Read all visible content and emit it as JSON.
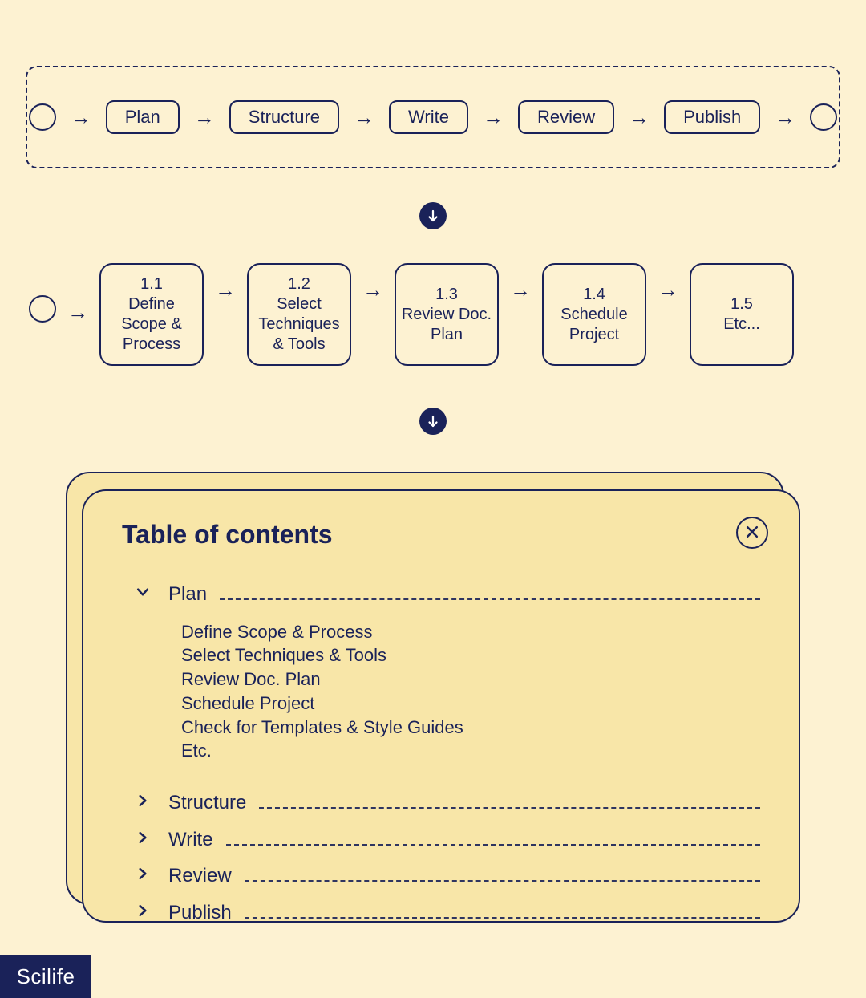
{
  "flow_top": {
    "steps": [
      "Plan",
      "Structure",
      "Write",
      "Review",
      "Publish"
    ]
  },
  "flow_sub": {
    "boxes": [
      {
        "num": "1.1",
        "label": "Define Scope & Process"
      },
      {
        "num": "1.2",
        "label": "Select Techniques & Tools"
      },
      {
        "num": "1.3",
        "label": "Review Doc. Plan"
      },
      {
        "num": "1.4",
        "label": "Schedule Project"
      },
      {
        "num": "1.5",
        "label": "Etc..."
      }
    ]
  },
  "toc": {
    "title": "Table of contents",
    "items": [
      {
        "label": "Plan",
        "expanded": true,
        "children": [
          "Define Scope & Process",
          "Select Techniques & Tools",
          "Review Doc. Plan",
          "Schedule Project",
          "Check for Templates & Style Guides",
          "Etc."
        ]
      },
      {
        "label": "Structure",
        "expanded": false
      },
      {
        "label": "Write",
        "expanded": false
      },
      {
        "label": "Review",
        "expanded": false
      },
      {
        "label": "Publish",
        "expanded": false
      }
    ]
  },
  "brand": "Scilife"
}
